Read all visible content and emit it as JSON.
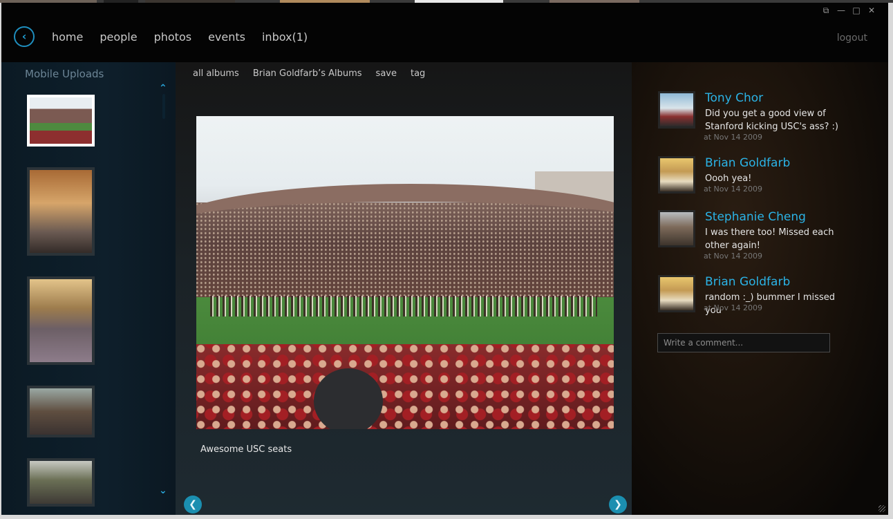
{
  "window": {
    "minimize": "—",
    "maximize": "□",
    "close": "✕",
    "restore": "⧉"
  },
  "nav": {
    "back_icon": "back-arrow-icon",
    "items": [
      "home",
      "people",
      "photos",
      "events",
      "inbox(1)"
    ],
    "logout": "logout"
  },
  "sidebar": {
    "title": "Mobile Uploads",
    "thumb_count": 5
  },
  "album_nav": [
    "all albums",
    "Brian Goldfarb’s Albums",
    "save",
    "tag"
  ],
  "photo": {
    "caption": "Awesome USC seats"
  },
  "comments": [
    {
      "name": "Tony Chor",
      "text": "Did you get a good view of Stanford kicking USC's ass? :)",
      "time": "at Nov 14 2009"
    },
    {
      "name": "Brian Goldfarb",
      "text": "Oooh yea!",
      "time": "at Nov 14 2009"
    },
    {
      "name": "Stephanie Cheng",
      "text": "I was there too!  Missed each other again!",
      "time": "at Nov 14 2009"
    },
    {
      "name": "Brian Goldfarb",
      "text": "random :_) bummer I missed you",
      "time": "at Nov 14 2009"
    }
  ],
  "comment_input": {
    "placeholder": "Write a comment..."
  },
  "colors": {
    "accent": "#2bb3e6",
    "text": "#c9c9c9",
    "background": "#040404"
  }
}
